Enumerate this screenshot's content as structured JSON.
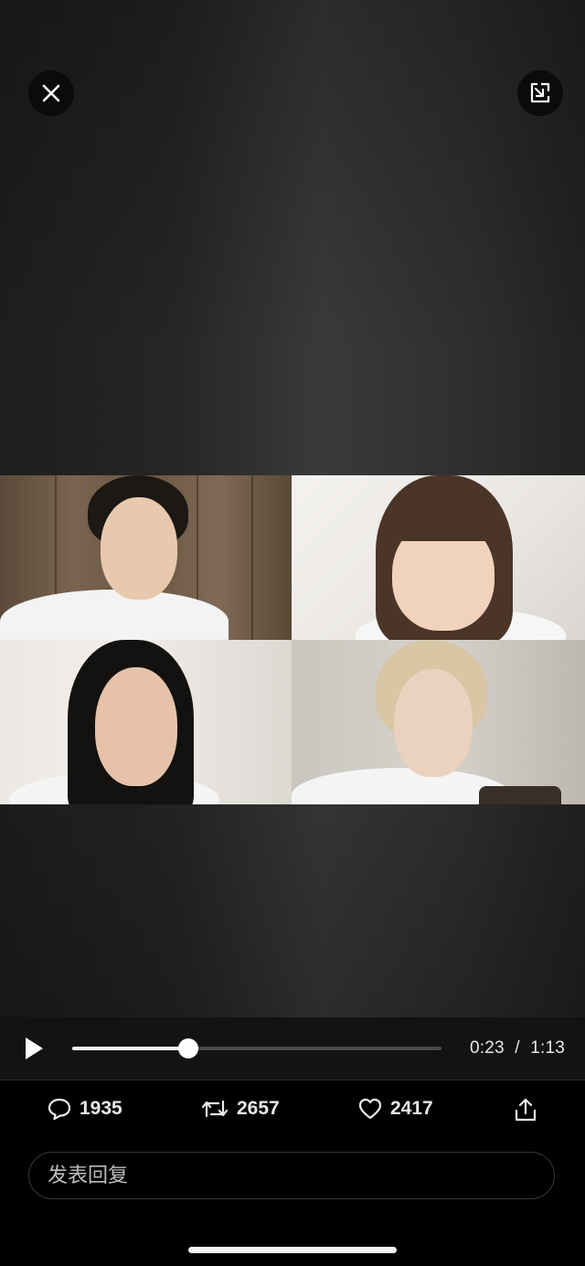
{
  "video": {
    "participants": [
      {
        "name": "participant-top-left"
      },
      {
        "name": "participant-top-right"
      },
      {
        "name": "participant-bottom-left"
      },
      {
        "name": "participant-bottom-right"
      }
    ]
  },
  "top_buttons": {
    "close_icon": "close-icon",
    "minimize_icon": "exit-fullscreen-icon"
  },
  "player": {
    "current_time": "0:23",
    "separator": "/",
    "duration": "1:13",
    "progress": 0.315
  },
  "actions": {
    "reply_count": "1935",
    "retweet_count": "2657",
    "like_count": "2417"
  },
  "reply": {
    "placeholder": "发表回复"
  },
  "colors": {
    "background": "#000000",
    "controls_bar": "#131313",
    "text": "#eaeaea"
  }
}
